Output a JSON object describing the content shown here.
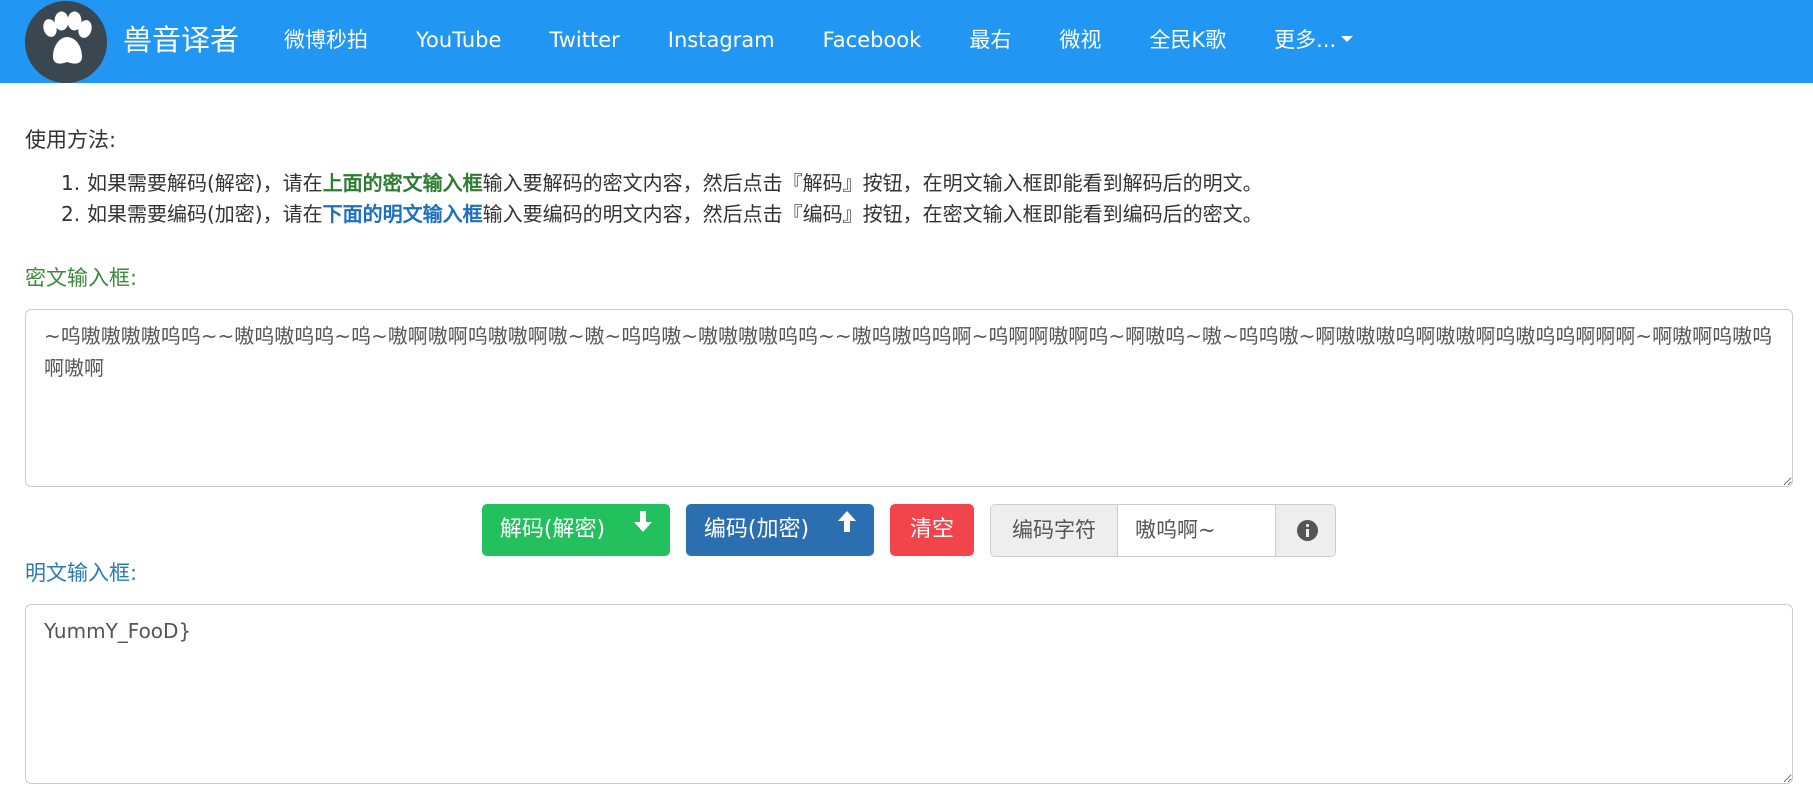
{
  "brand": {
    "name": "兽音译者",
    "logo_icon": "paw-icon"
  },
  "nav": {
    "items": [
      {
        "label": "微博秒拍"
      },
      {
        "label": "YouTube"
      },
      {
        "label": "Twitter"
      },
      {
        "label": "Instagram"
      },
      {
        "label": "Facebook"
      },
      {
        "label": "最右"
      },
      {
        "label": "微视"
      },
      {
        "label": "全民K歌"
      }
    ],
    "more_label": "更多..."
  },
  "usage": {
    "title": "使用方法:",
    "steps": [
      {
        "num": "1.",
        "pre": "如果需要解码(解密)，请在",
        "highlight": "上面的密文输入框",
        "post": "输入要解码的密文内容，然后点击『解码』按钮，在明文输入框即能看到解码后的明文。"
      },
      {
        "num": "2.",
        "pre": "如果需要编码(加密)，请在",
        "highlight": "下面的明文输入框",
        "post": "输入要编码的明文内容，然后点击『编码』按钮，在密文输入框即能看到编码后的密文。"
      }
    ]
  },
  "cipher": {
    "label": "密文输入框:",
    "value": "~呜嗷嗷嗷嗷呜呜~~嗷呜嗷呜呜~呜~嗷啊嗷啊呜嗷嗷啊嗷~嗷~呜呜嗷~嗷嗷嗷嗷呜呜~~嗷呜嗷呜呜啊~呜啊啊嗷啊呜~啊嗷呜~嗷~呜呜嗷~啊嗷嗷嗷呜啊嗷嗷啊呜嗷呜呜啊啊啊~啊嗷啊呜嗷呜啊嗷啊"
  },
  "actions": {
    "decode_label": "解码(解密)",
    "encode_label": "编码(加密)",
    "clear_label": "清空",
    "charset_label": "编码字符",
    "charset_value": "嗷呜啊~"
  },
  "plain": {
    "label": "明文输入框:",
    "value": "YummY_FooD}"
  },
  "colors": {
    "navbar": "#2196f3",
    "decode": "#22c15e",
    "encode": "#2b6fb0",
    "clear": "#f2444b",
    "cipher_label": "#3c8a3c",
    "plain_label": "#2a7ab8"
  }
}
